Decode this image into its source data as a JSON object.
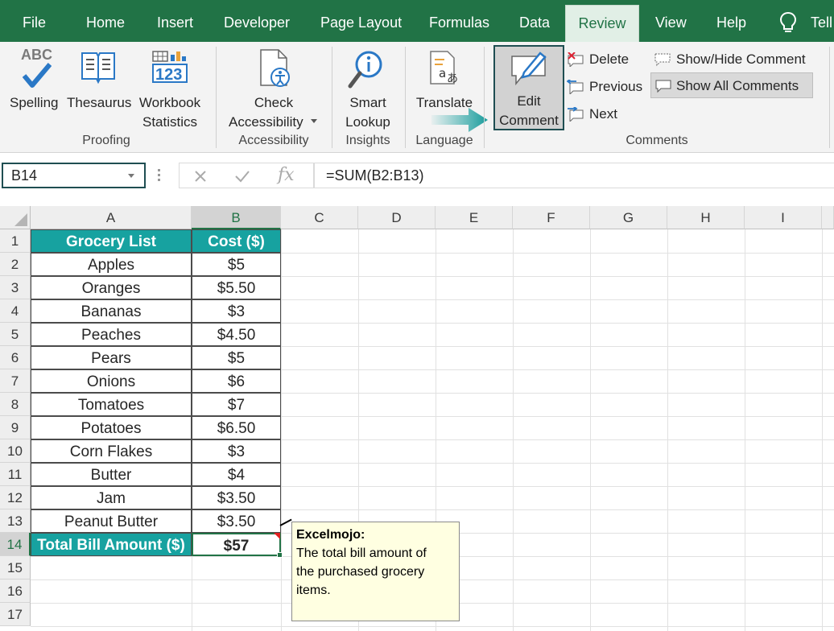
{
  "menu": {
    "tabs": [
      {
        "label": "File"
      },
      {
        "label": "Home"
      },
      {
        "label": "Insert"
      },
      {
        "label": "Developer"
      },
      {
        "label": "Page Layout"
      },
      {
        "label": "Formulas"
      },
      {
        "label": "Data"
      },
      {
        "label": "Review"
      },
      {
        "label": "View"
      },
      {
        "label": "Help"
      },
      {
        "label": "Tell"
      }
    ],
    "active_tab": "Review"
  },
  "ribbon": {
    "spelling": "Spelling",
    "spelling_abc": "ABC",
    "thesaurus": "Thesaurus",
    "workbook_line1": "Workbook",
    "workbook_line2": "Statistics",
    "workbook_num": "123",
    "proofing_group": "Proofing",
    "check_line1": "Check",
    "check_line2": "Accessibility",
    "accessibility_group": "Accessibility",
    "smart_line1": "Smart",
    "smart_line2": "Lookup",
    "insights_group": "Insights",
    "translate": "Translate",
    "language_group": "Language",
    "edit_line1": "Edit",
    "edit_line2": "Comment",
    "delete": "Delete",
    "previous": "Previous",
    "next": "Next",
    "show_hide": "Show/Hide Comment",
    "show_all": "Show All Comments",
    "comments_group": "Comments"
  },
  "formula_bar": {
    "name_box": "B14",
    "formula": "=SUM(B2:B13)"
  },
  "grid": {
    "columns": [
      "A",
      "B",
      "C",
      "D",
      "E",
      "F",
      "G",
      "H",
      "I"
    ],
    "selected_column": "B",
    "row_numbers": [
      "1",
      "2",
      "3",
      "4",
      "5",
      "6",
      "7",
      "8",
      "9",
      "10",
      "11",
      "12",
      "13",
      "14",
      "15",
      "16",
      "17"
    ],
    "selected_row": "14",
    "header": {
      "a": "Grocery List",
      "b": "Cost ($)"
    },
    "rows": [
      {
        "a": "Apples",
        "b": "$5"
      },
      {
        "a": "Oranges",
        "b": "$5.50"
      },
      {
        "a": "Bananas",
        "b": "$3"
      },
      {
        "a": "Peaches",
        "b": "$4.50"
      },
      {
        "a": "Pears",
        "b": "$5"
      },
      {
        "a": "Onions",
        "b": "$6"
      },
      {
        "a": "Tomatoes",
        "b": "$7"
      },
      {
        "a": "Potatoes",
        "b": "$6.50"
      },
      {
        "a": "Corn Flakes",
        "b": "$3"
      },
      {
        "a": "Butter",
        "b": "$4"
      },
      {
        "a": "Jam",
        "b": "$3.50"
      },
      {
        "a": "Peanut Butter",
        "b": "$3.50"
      }
    ],
    "total": {
      "a": "Total Bill Amount ($)",
      "b": "$57"
    }
  },
  "comment": {
    "author": "Excelmojo:",
    "line1": "The total bill amount of",
    "line2": "the purchased grocery",
    "line3": "items."
  },
  "colors": {
    "excel_green": "#217346",
    "header_teal": "#17a2a0",
    "comment_bg": "#ffffe1",
    "focus_border": "#1f4e52"
  }
}
